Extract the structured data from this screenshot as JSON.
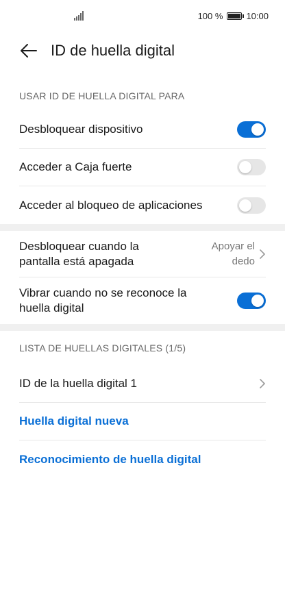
{
  "statusbar": {
    "battery_text": "100 %",
    "time": "10:00"
  },
  "header": {
    "title": "ID de huella digital"
  },
  "section1": {
    "title": "USAR ID DE HUELLA DIGITAL PARA",
    "items": [
      {
        "label": "Desbloquear dispositivo",
        "on": true
      },
      {
        "label": "Acceder a Caja fuerte",
        "on": false
      },
      {
        "label": "Acceder al bloqueo de aplicaciones",
        "on": false
      }
    ]
  },
  "section2": {
    "unlock_screen_off": {
      "label_line1": "Desbloquear cuando la",
      "label_line2": "pantalla está apagada",
      "value_line1": "Apoyar el",
      "value_line2": "dedo"
    },
    "vibrate": {
      "label_line1": "Vibrar cuando no se reconoce la",
      "label_line2": "huella digital",
      "on": true
    }
  },
  "section3": {
    "title": "LISTA DE HUELLAS DIGITALES (1/5)",
    "fingerprint_item": "ID de la huella digital 1",
    "new_fingerprint": "Huella digital nueva",
    "recognition": "Reconocimiento de huella digital"
  },
  "colors": {
    "accent": "#0a6fd6",
    "toggle_off": "#e6e6e6",
    "divider": "#f0f0f0"
  }
}
